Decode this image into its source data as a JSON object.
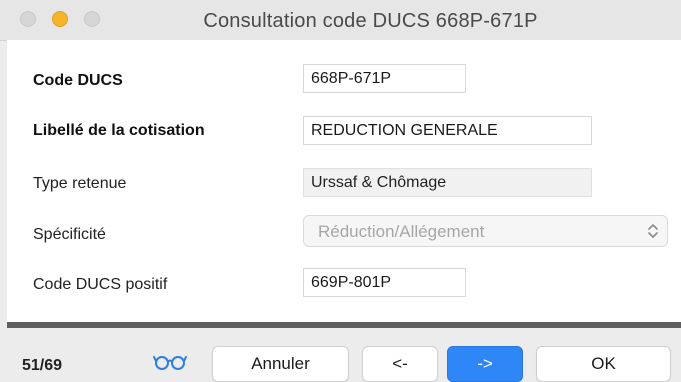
{
  "window": {
    "title": "Consultation code DUCS 668P-671P"
  },
  "form": {
    "code_ducs": {
      "label": "Code DUCS",
      "value": "668P-671P"
    },
    "libelle": {
      "label": "Libellé de la cotisation",
      "value": "REDUCTION GENERALE"
    },
    "type_retenue": {
      "label": "Type retenue",
      "value": "Urssaf & Chômage"
    },
    "specificite": {
      "label": "Spécificité",
      "value": "Réduction/Allégement"
    },
    "code_positif": {
      "label": "Code DUCS positif",
      "value": "669P-801P"
    }
  },
  "footer": {
    "record_counter": "51/69",
    "view_icon": "glasses-icon",
    "cancel_label": "Annuler",
    "prev_label": "<-",
    "next_label": "->",
    "ok_label": "OK"
  },
  "colors": {
    "accent": "#2f86f6",
    "minimize": "#f5b52b",
    "separator": "#5f5f5f",
    "icon_blue": "#2f7de1"
  }
}
